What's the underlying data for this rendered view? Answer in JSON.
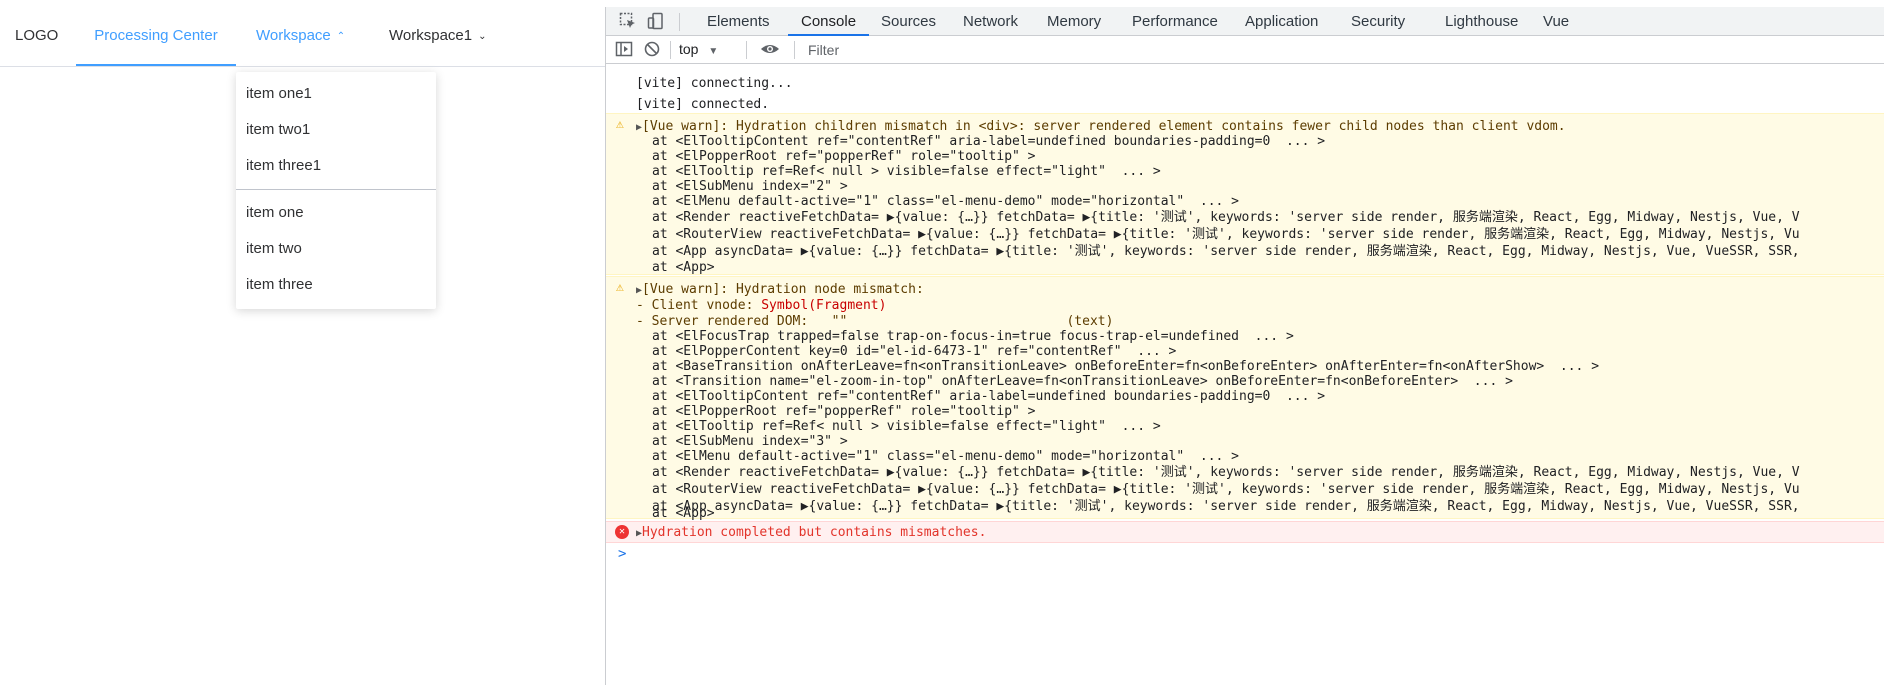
{
  "app": {
    "logo": "LOGO",
    "menu": {
      "processing_center": "Processing Center",
      "workspace": "Workspace",
      "workspace1": "Workspace1"
    },
    "dropdown_items": [
      "item one1",
      "item two1",
      "item three1",
      "item one",
      "item two",
      "item three"
    ],
    "colors": {
      "accent": "#409eff"
    }
  },
  "devtools": {
    "tabs": [
      "Elements",
      "Console",
      "Sources",
      "Network",
      "Memory",
      "Performance",
      "Application",
      "Security",
      "Lighthouse",
      "Vue"
    ],
    "active_tab": "Console",
    "context": "top",
    "filter_placeholder": "Filter",
    "console": {
      "info": [
        "[vite] connecting...",
        "[vite] connected."
      ],
      "warn1": {
        "header": "[Vue warn]: Hydration children mismatch in <div>: server rendered element contains fewer child nodes than client vdom.",
        "stack": [
          "at <ElTooltipContent ref=\"contentRef\" aria-label=undefined boundaries-padding=0  ... >",
          "at <ElPopperRoot ref=\"popperRef\" role=\"tooltip\" >",
          "at <ElTooltip ref=Ref< null > visible=false effect=\"light\"  ... >",
          "at <ElSubMenu index=\"2\" >",
          "at <ElMenu default-active=\"1\" class=\"el-menu-demo\" mode=\"horizontal\"  ... >",
          "at <Render reactiveFetchData= ▶{value: {…}} fetchData= ▶{title: '测试', keywords: 'server side render, 服务端渲染, React, Egg, Midway, Nestjs, Vue, V",
          "at <RouterView reactiveFetchData= ▶{value: {…}} fetchData= ▶{title: '测试', keywords: 'server side render, 服务端渲染, React, Egg, Midway, Nestjs, Vu",
          "at <App asyncData= ▶{value: {…}} fetchData= ▶{title: '测试', keywords: 'server side render, 服务端渲染, React, Egg, Midway, Nestjs, Vue, VueSSR, SSR,",
          "at <App>"
        ]
      },
      "warn2": {
        "header": "[Vue warn]: Hydration node mismatch:",
        "client_vnode_label": "- Client vnode: ",
        "client_vnode_value": "Symbol(Fragment)",
        "server_dom": "- Server rendered DOM:   \"\"                            (text)",
        "stack": [
          "at <ElFocusTrap trapped=false trap-on-focus-in=true focus-trap-el=undefined  ... >",
          "at <ElPopperContent key=0 id=\"el-id-6473-1\" ref=\"contentRef\"  ... >",
          "at <BaseTransition onAfterLeave=fn<onTransitionLeave> onBeforeEnter=fn<onBeforeEnter> onAfterEnter=fn<onAfterShow>  ... >",
          "at <Transition name=\"el-zoom-in-top\" onAfterLeave=fn<onTransitionLeave> onBeforeEnter=fn<onBeforeEnter>  ... >",
          "at <ElTooltipContent ref=\"contentRef\" aria-label=undefined boundaries-padding=0  ... >",
          "at <ElPopperRoot ref=\"popperRef\" role=\"tooltip\" >",
          "at <ElTooltip ref=Ref< null > visible=false effect=\"light\"  ... >",
          "at <ElSubMenu index=\"3\" >",
          "at <ElMenu default-active=\"1\" class=\"el-menu-demo\" mode=\"horizontal\"  ... >",
          "at <Render reactiveFetchData= ▶{value: {…}} fetchData= ▶{title: '测试', keywords: 'server side render, 服务端渲染, React, Egg, Midway, Nestjs, Vue, V",
          "at <RouterView reactiveFetchData= ▶{value: {…}} fetchData= ▶{title: '测试', keywords: 'server side render, 服务端渲染, React, Egg, Midway, Nestjs, Vu",
          "at <App asyncData= ▶{value: {…}} fetchData= ▶{title: '测试', keywords: 'server side render, 服务端渲染, React, Egg, Midway, Nestjs, Vue, VueSSR, SSR,",
          "at <App>"
        ]
      },
      "error": "Hydration completed but contains mismatches.",
      "prompt_symbol": ">"
    },
    "colors": {
      "tab_accent": "#1a73e8",
      "warn_bg": "#fffbe5",
      "error_bg": "#fff0f0",
      "error_text": "#e2342b"
    },
    "icons": [
      "inspect-icon",
      "device-toggle-icon",
      "sidebar-toggle-icon",
      "clear-console-icon",
      "eye-icon"
    ]
  }
}
